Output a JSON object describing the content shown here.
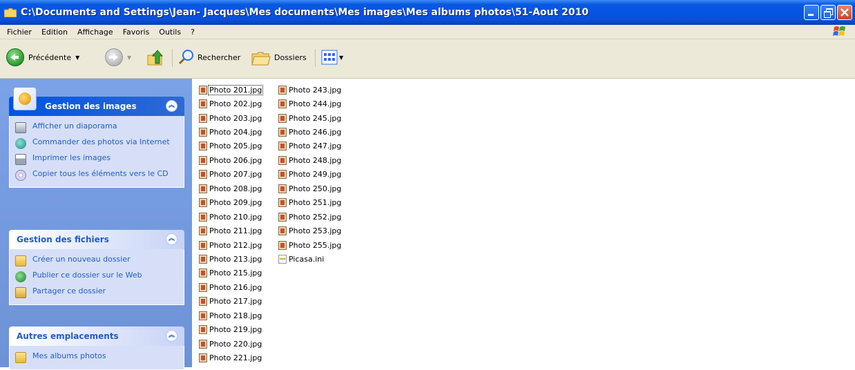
{
  "window": {
    "title": "C:\\Documents and Settings\\Jean- Jacques\\Mes documents\\Mes images\\Mes albums photos\\51-Aout 2010"
  },
  "menu": [
    "Fichier",
    "Edition",
    "Affichage",
    "Favoris",
    "Outils",
    "?"
  ],
  "toolbar": {
    "back_label": "Précédente",
    "search_label": "Rechercher",
    "folders_label": "Dossiers"
  },
  "groups": [
    {
      "title": "Gestion des images",
      "tasks": [
        "Afficher un diaporama",
        "Commander des photos via Internet",
        "Imprimer les images",
        "Copier tous les éléments vers le CD"
      ]
    },
    {
      "title": "Gestion des fichiers",
      "tasks": [
        "Créer un nouveau dossier",
        "Publier ce dossier sur le Web",
        "Partager ce dossier"
      ]
    },
    {
      "title": "Autres emplacements",
      "tasks": [
        "Mes albums photos"
      ]
    }
  ],
  "files": {
    "column1": [
      "Photo 201.jpg",
      "Photo 202.jpg",
      "Photo 203.jpg",
      "Photo 204.jpg",
      "Photo 205.jpg",
      "Photo 206.jpg",
      "Photo 207.jpg",
      "Photo 208.jpg",
      "Photo 209.jpg",
      "Photo 210.jpg",
      "Photo 211.jpg",
      "Photo 212.jpg",
      "Photo 213.jpg",
      "Photo 215.jpg",
      "Photo 216.jpg",
      "Photo 217.jpg",
      "Photo 218.jpg",
      "Photo 219.jpg",
      "Photo 220.jpg",
      "Photo 221.jpg"
    ],
    "column2": [
      "Photo 243.jpg",
      "Photo 244.jpg",
      "Photo 245.jpg",
      "Photo 246.jpg",
      "Photo 247.jpg",
      "Photo 248.jpg",
      "Photo 249.jpg",
      "Photo 250.jpg",
      "Photo 251.jpg",
      "Photo 252.jpg",
      "Photo 253.jpg",
      "Photo 255.jpg",
      "Picasa.ini"
    ]
  },
  "colors": {
    "titlebar": "#0554e4",
    "panel": "#7ba2e7",
    "link": "#215dc6",
    "chrome": "#ece9d8"
  }
}
